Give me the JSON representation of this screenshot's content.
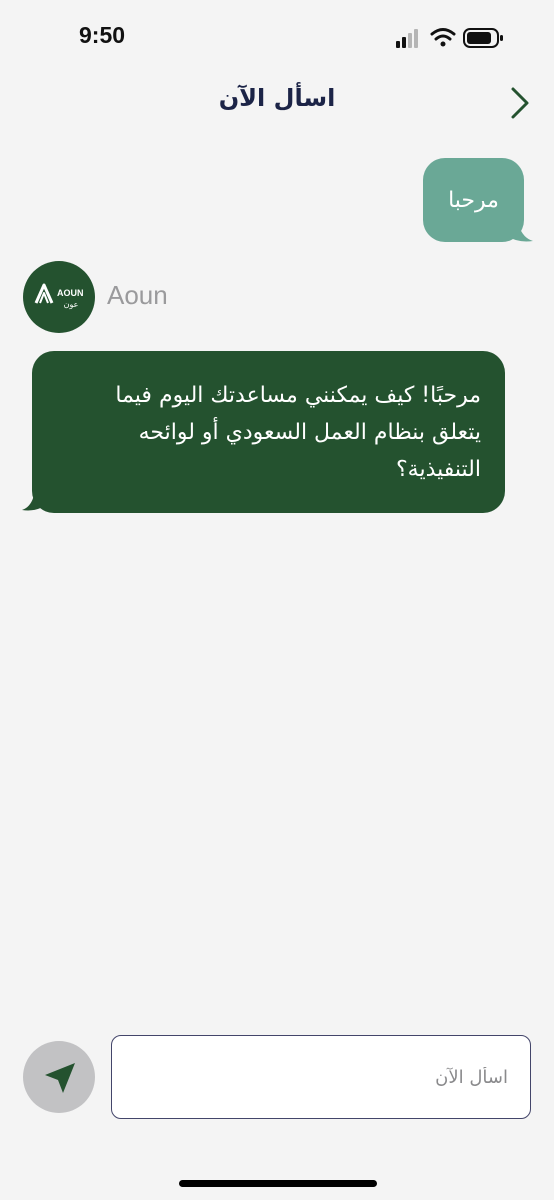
{
  "status_bar": {
    "time": "9:50"
  },
  "header": {
    "title": "اسأل الآن"
  },
  "messages": {
    "user": {
      "text": "مرحبا"
    },
    "bot": {
      "sender": "Aoun",
      "logo_text_en": "AOUN",
      "logo_text_ar": "عون",
      "line1": "مرحبًا! كيف يمكنني مساعدتك اليوم فيما",
      "line2": "يتعلق بنظام العمل السعودي أو لوائحه",
      "line3": "التنفيذية؟"
    }
  },
  "composer": {
    "placeholder": "اسأل الآن"
  },
  "colors": {
    "accent_dark": "#24522f",
    "user_bubble": "#6aa896",
    "title": "#1c2447"
  }
}
